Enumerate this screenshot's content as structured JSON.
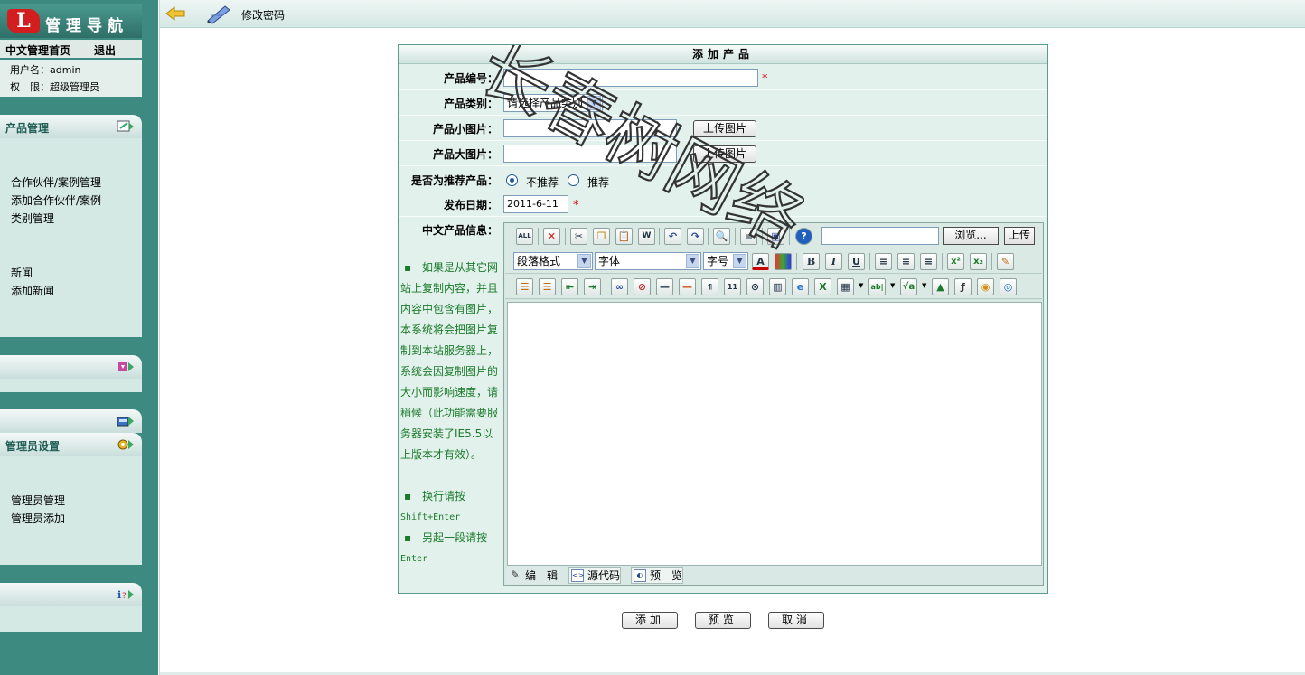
{
  "sidebar": {
    "logo_mark": "L",
    "logo_title": "管理导航",
    "nav": {
      "home": "中文管理首页",
      "logout": "退出"
    },
    "user": {
      "username_line": "用户名：admin",
      "role_line": "权　限：超级管理员"
    },
    "panels": {
      "product": {
        "title": "产品管理",
        "icon": "edit-icon",
        "items": [
          "合作伙伴/案例管理",
          "添加合作伙伴/案例",
          "类别管理",
          "新闻",
          "添加新闻"
        ]
      },
      "panel2": {
        "icon": "download-icon"
      },
      "panel3": {
        "icon": "folder-icon"
      },
      "admin": {
        "title": "管理员设置",
        "icon": "gear-icon",
        "items": [
          "管理员管理",
          "管理员添加"
        ]
      },
      "panel5": {
        "icon": "info-icon"
      }
    }
  },
  "topbar": {
    "back_icon": "back-arrow-icon",
    "pen_icon": "pen-icon",
    "label": "修改密码"
  },
  "form": {
    "title": "添加产品",
    "fields": {
      "code": {
        "label": "产品编号：",
        "value": ""
      },
      "category": {
        "label": "产品类别：",
        "value": "请选择产品类别"
      },
      "small_image": {
        "label": "产品小图片：",
        "value": "",
        "button": "上传图片"
      },
      "large_image": {
        "label": "产品大图片：",
        "value": "",
        "button": "上传图片"
      },
      "recommend": {
        "label": "是否为推荐产品：",
        "options": [
          "不推荐",
          "推荐"
        ],
        "selected": "不推荐"
      },
      "date": {
        "label": "发布日期：",
        "value": "2011-6-11"
      },
      "info": {
        "label": "中文产品信息："
      }
    },
    "required_mark": "*",
    "hint": {
      "b1": "▪",
      "p1": "如果是从其它网站上复制内容，并且内容中包含有图片，本系统将会把图片复制到本站服务器上，系统会因复制图片的大小而影响速度，请稍候（此功能需要服务器安装了IE5.5以上版本才有效）。",
      "b2": "▪",
      "p2a": "换行请按",
      "p2b": "Shift+Enter",
      "b3": "▪",
      "p3a": "另起一段请按",
      "p3b": "Enter"
    },
    "editor": {
      "browse_label": "浏览...",
      "upload_label": "上传",
      "format_select": "段落格式",
      "font_select": "字体",
      "size_select": "字号",
      "tabs": [
        "编　辑",
        "源代码",
        "预　览"
      ]
    },
    "buttons": {
      "add": "添加",
      "preview": "预览",
      "cancel": "取消"
    }
  },
  "watermark": "长春树网络"
}
